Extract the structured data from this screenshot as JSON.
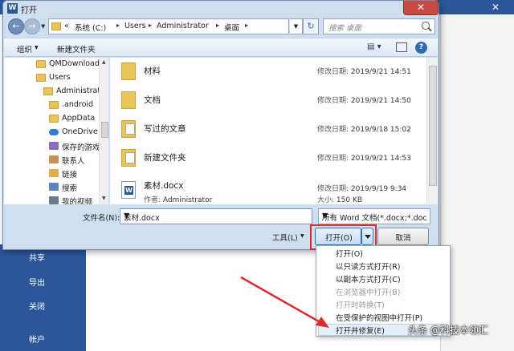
{
  "dialog": {
    "title": "打开",
    "close_glyph": "✕",
    "address": {
      "crumbs": [
        "«",
        "系统 (C:)",
        "Users",
        "Administrator",
        "桌面"
      ],
      "search_placeholder": "搜索 桌面"
    },
    "toolbar": {
      "organize": "组织",
      "new_folder": "新建文件夹"
    },
    "nav_tree": [
      {
        "label": "QMDownload",
        "icon": "folder-icon"
      },
      {
        "label": "Users",
        "icon": "folder-icon"
      },
      {
        "label": "Administrato",
        "icon": "folder-icon"
      },
      {
        "label": ".android",
        "icon": "folder-icon"
      },
      {
        "label": "AppData",
        "icon": "folder-icon"
      },
      {
        "label": "OneDrive",
        "icon": "cloud-icon"
      },
      {
        "label": "保存的游戏",
        "icon": "game-icon"
      },
      {
        "label": "联系人",
        "icon": "contact-icon"
      },
      {
        "label": "链接",
        "icon": "link-icon"
      },
      {
        "label": "搜索",
        "icon": "search-icon"
      },
      {
        "label": "我的视频",
        "icon": "video-icon"
      }
    ],
    "files": [
      {
        "name": "材料",
        "meta_label": "修改日期:",
        "meta_value": "2019/9/21 14:51",
        "icon": "folder-icon"
      },
      {
        "name": "文档",
        "meta_label": "修改日期:",
        "meta_value": "2019/9/21 14:50",
        "icon": "folder-icon"
      },
      {
        "name": "写过的文章",
        "meta_label": "修改日期:",
        "meta_value": "2019/9/18 15:02",
        "icon": "folder-doc-icon"
      },
      {
        "name": "新建文件夹",
        "meta_label": "修改日期:",
        "meta_value": "2019/9/21 14:53",
        "icon": "folder-doc-icon"
      },
      {
        "name": "素材.docx",
        "meta_label": "修改日期:",
        "meta_value": "2019/9/19 9:34",
        "author_label": "作者:",
        "author": "Administrator",
        "size_label": "大小:",
        "size": "150 KB",
        "icon": "docx-icon"
      }
    ],
    "filename_label": "文件名(N):",
    "filename_value": "素材.docx",
    "filetype_value": "所有 Word 文档(*.docx;*.doc",
    "tools_label": "工具(L)",
    "open_label": "打开(O)",
    "cancel_label": "取消"
  },
  "open_menu": [
    {
      "label": "打开(O)",
      "disabled": false
    },
    {
      "label": "以只读方式打开(R)",
      "disabled": false
    },
    {
      "label": "以副本方式打开(C)",
      "disabled": false
    },
    {
      "label": "在浏览器中打开(B)",
      "disabled": true
    },
    {
      "label": "打开时转换(T)",
      "disabled": true
    },
    {
      "label": "在受保护的视图中打开(P)",
      "disabled": false
    },
    {
      "label": "打开并修复(E)",
      "disabled": false
    }
  ],
  "backstage_nav": [
    "共享",
    "导出",
    "关闭",
    "帐户"
  ],
  "watermark": "头条 @科技本领汇",
  "colors": {
    "word_blue": "#2b579a",
    "highlight_red": "#e02b2b"
  }
}
